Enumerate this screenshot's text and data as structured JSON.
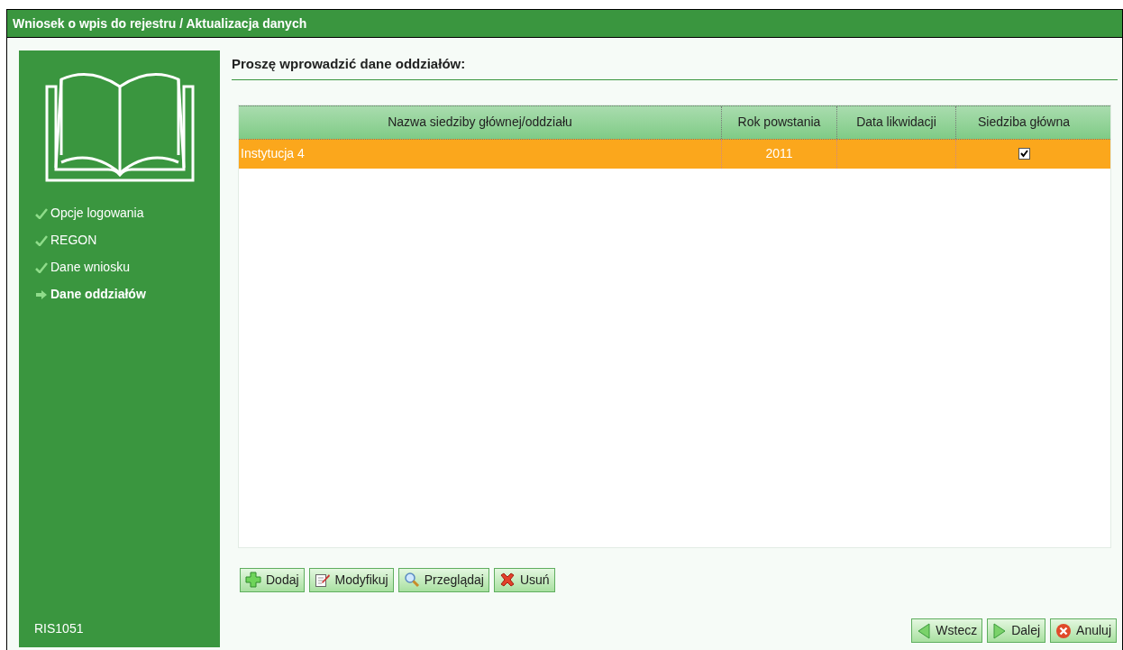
{
  "window": {
    "title": "Wniosek o wpis do rejestru / Aktualizacja danych"
  },
  "sidebar": {
    "steps": [
      {
        "label": "Opcje logowania",
        "kind": "done"
      },
      {
        "label": "REGON",
        "kind": "done"
      },
      {
        "label": "Dane wniosku",
        "kind": "done"
      },
      {
        "label": "Dane oddziałów",
        "kind": "current"
      }
    ],
    "code": "RIS1051"
  },
  "heading": "Proszę wprowadzić dane oddziałów:",
  "table": {
    "columns": [
      "Nazwa siedziby głównej/oddziału",
      "Rok powstania",
      "Data likwidacji",
      "Siedziba główna"
    ],
    "rows": [
      {
        "name": "Instytucja 4",
        "year": "2011",
        "liquidation_date": "",
        "head_office": true,
        "selected": true
      }
    ]
  },
  "actions": [
    {
      "label": "Dodaj",
      "kind": "add"
    },
    {
      "label": "Modyfikuj",
      "kind": "edit"
    },
    {
      "label": "Przeglądaj",
      "kind": "view"
    },
    {
      "label": "Usuń",
      "kind": "delete"
    }
  ],
  "nav": [
    {
      "label": "Wstecz",
      "kind": "back"
    },
    {
      "label": "Dalej",
      "kind": "next"
    },
    {
      "label": "Anuluj",
      "kind": "cancel"
    }
  ]
}
